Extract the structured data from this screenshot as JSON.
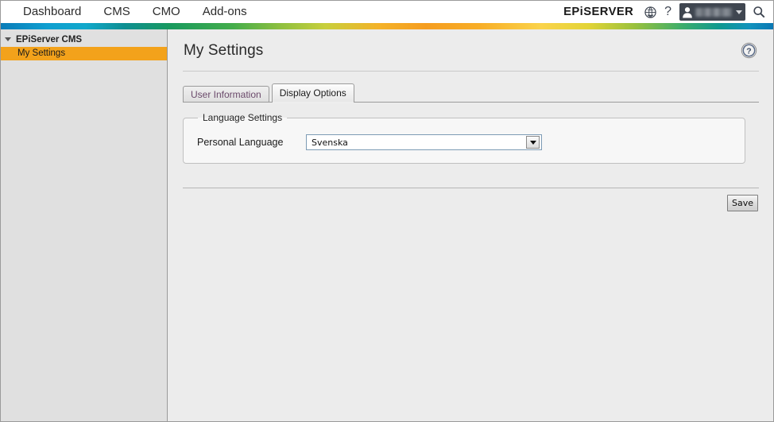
{
  "topnav": {
    "items": [
      {
        "label": "Dashboard",
        "name": "nav-dashboard"
      },
      {
        "label": "CMS",
        "name": "nav-cms"
      },
      {
        "label": "CMO",
        "name": "nav-cmo"
      },
      {
        "label": "Add-ons",
        "name": "nav-addons"
      }
    ],
    "brand": "EPiSERVER",
    "help_glyph": "?",
    "globe_icon": "globe-icon",
    "search_icon": "search-icon",
    "user_icon": "user-avatar-icon",
    "user_name": ""
  },
  "sidebar": {
    "root_label": "EPiServer CMS",
    "items": [
      {
        "label": "My Settings",
        "selected": true
      }
    ]
  },
  "page": {
    "title": "My Settings",
    "help_icon": "help-circle-icon"
  },
  "tabs": [
    {
      "label": "User Information",
      "active": false
    },
    {
      "label": "Display Options",
      "active": true
    }
  ],
  "language_settings": {
    "legend": "Language Settings",
    "field_label": "Personal Language",
    "selected_value": "Svenska",
    "dropdown_icon": "chevron-down-icon"
  },
  "footer": {
    "save_label": "Save"
  },
  "colors": {
    "accent_orange": "#f3a21b",
    "sidebar_bg": "#e0e0e0",
    "main_bg": "#ececec",
    "chip_bg": "#3f4650",
    "select_border": "#7d9bb5"
  }
}
